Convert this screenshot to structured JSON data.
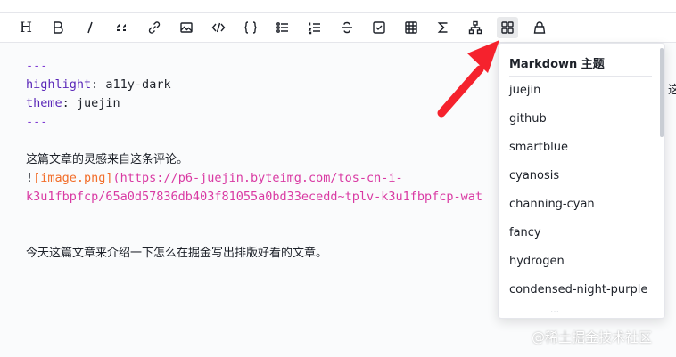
{
  "toolbar": {
    "heading_label": "H",
    "items": [
      "heading",
      "bold",
      "italic",
      "quote",
      "link",
      "image",
      "code",
      "code-block",
      "unordered-list",
      "ordered-list",
      "strikethrough",
      "task-list",
      "table",
      "formula",
      "diagram",
      "theme",
      "help"
    ]
  },
  "editor": {
    "line1": "---",
    "line2_key": "highlight",
    "line2_colon": ": ",
    "line2_val": "a11y-dark",
    "line3_key": "theme",
    "line3_colon": ": ",
    "line3_val": "juejin",
    "line4": "---",
    "line6": "这篇文章的灵感来自这条评论。",
    "line7_bang": "!",
    "line7_link": "[image.png]",
    "line7_url": "(https://p6-juejin.byteimg.com/tos-cn-i-",
    "line8_url": "k3u1fbpfcp/65a0d57836db403f81055a0bd33ecedd~tplv-k3u1fbpfcp-wat",
    "line11": "今天这篇文章来介绍一下怎么在掘金写出排版好看的文章。"
  },
  "right_edge_char": "这",
  "dropdown": {
    "title": "Markdown 主题",
    "items": [
      "juejin",
      "github",
      "smartblue",
      "cyanosis",
      "channing-cyan",
      "fancy",
      "hydrogen",
      "condensed-night-purple"
    ],
    "more": "…"
  },
  "watermark": "@稀土掘金技术社区",
  "colors": {
    "arrow": "#f5222d",
    "accent_purple": "#7e3bd3",
    "link_orange": "#f26e2a"
  }
}
